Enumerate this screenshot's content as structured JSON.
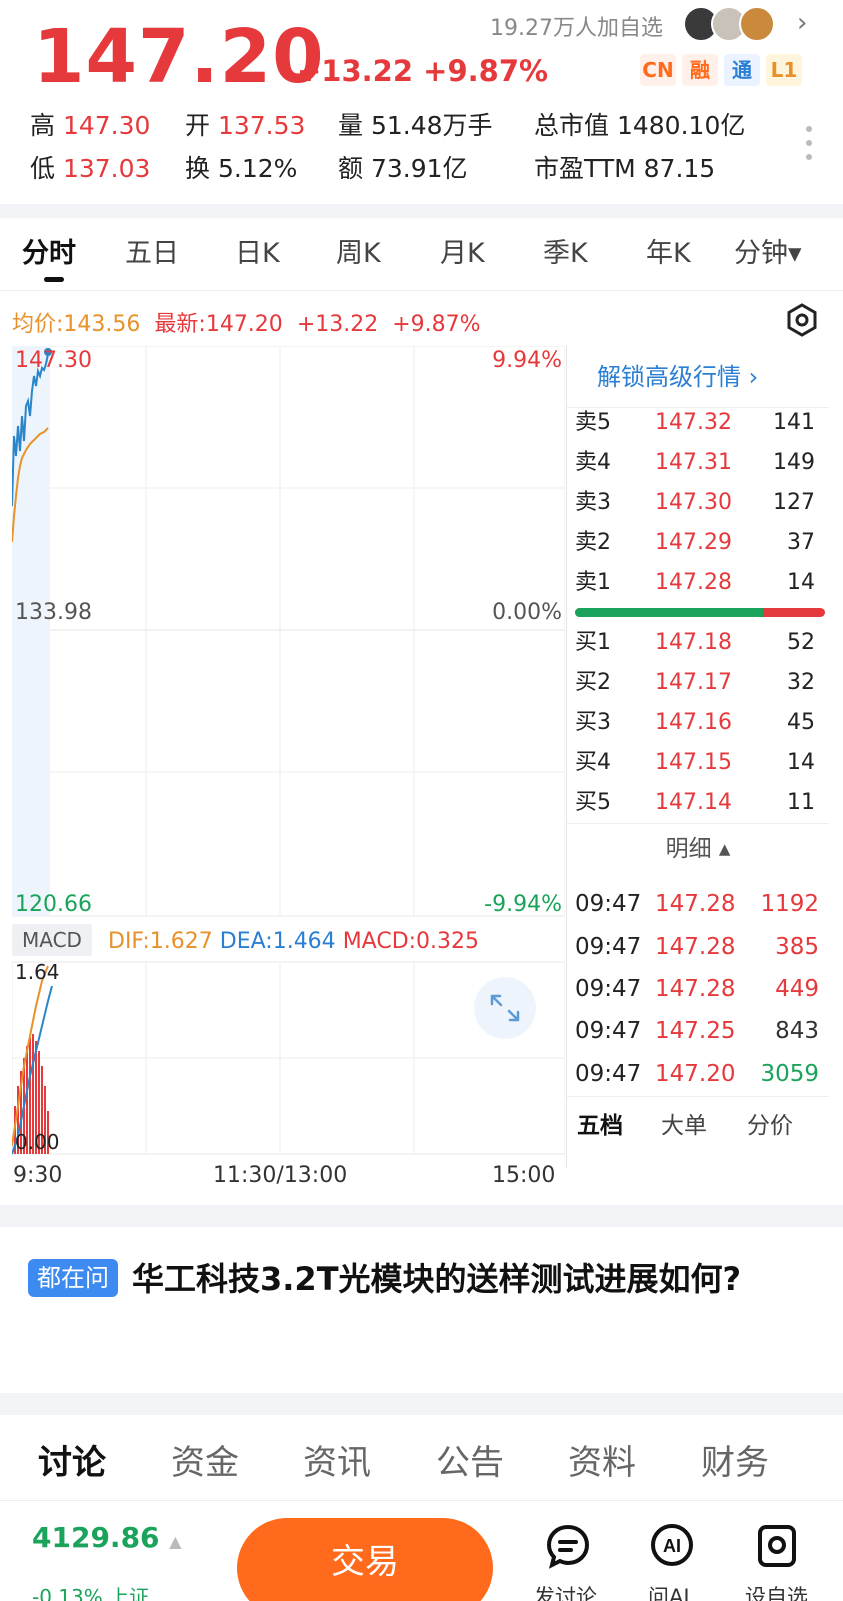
{
  "header": {
    "price": "147.20",
    "change": "+13.22",
    "change_pct": "+9.87%",
    "watch_count": "19.27万人加自选",
    "badges": [
      "CN",
      "融",
      "通",
      "L1"
    ],
    "stats": {
      "high_label": "高",
      "high": "147.30",
      "low_label": "低",
      "low": "137.03",
      "open_label": "开",
      "open": "137.53",
      "turnover_label": "换",
      "turnover": "5.12%",
      "volume_label": "量",
      "volume": "51.48万手",
      "amount_label": "额",
      "amount": "73.91亿",
      "mktcap_label": "总市值",
      "mktcap": "1480.10亿",
      "pe_label": "市盈TTM",
      "pe": "87.15"
    }
  },
  "tabs": [
    {
      "label": "分时"
    },
    {
      "label": "五日"
    },
    {
      "label": "日K"
    },
    {
      "label": "周K"
    },
    {
      "label": "月K"
    },
    {
      "label": "季K"
    },
    {
      "label": "年K"
    },
    {
      "label": "分钟▾"
    }
  ],
  "avg_line": {
    "avg": "均价:143.56",
    "latest": "最新:147.20",
    "chg": "+13.22",
    "pct": "+9.87%"
  },
  "chart": {
    "y_top": "147.30",
    "y_mid": "133.98",
    "y_bot": "120.66",
    "pct_top": "9.94%",
    "pct_mid": "0.00%",
    "pct_bot": "-9.94%",
    "x_labels": [
      "9:30",
      "11:30/13:00",
      "15:00"
    ],
    "macd_tag": "MACD",
    "dif": "DIF:1.627",
    "dea": "DEA:1.464",
    "macd": "MACD:0.325",
    "macd_top": "1.64",
    "macd_bot": "0.00"
  },
  "orderbook": {
    "unlock": "解锁高级行情 ›",
    "asks": [
      {
        "label": "卖5",
        "price": "147.32",
        "vol": "141"
      },
      {
        "label": "卖4",
        "price": "147.31",
        "vol": "149"
      },
      {
        "label": "卖3",
        "price": "147.30",
        "vol": "127"
      },
      {
        "label": "卖2",
        "price": "147.29",
        "vol": "37"
      },
      {
        "label": "卖1",
        "price": "147.28",
        "vol": "14"
      }
    ],
    "bids": [
      {
        "label": "买1",
        "price": "147.18",
        "vol": "52"
      },
      {
        "label": "买2",
        "price": "147.17",
        "vol": "32"
      },
      {
        "label": "买3",
        "price": "147.16",
        "vol": "45"
      },
      {
        "label": "买4",
        "price": "147.15",
        "vol": "14"
      },
      {
        "label": "买5",
        "price": "147.14",
        "vol": "11"
      }
    ],
    "detail_header": "明细 ▴",
    "details": [
      {
        "time": "09:47",
        "price": "147.28",
        "vol": "1192",
        "color": "#e5393c"
      },
      {
        "time": "09:47",
        "price": "147.28",
        "vol": "385",
        "color": "#e5393c"
      },
      {
        "time": "09:47",
        "price": "147.28",
        "vol": "449",
        "color": "#e5393c"
      },
      {
        "time": "09:47",
        "price": "147.25",
        "vol": "843",
        "color": "#333333"
      },
      {
        "time": "09:47",
        "price": "147.20",
        "vol": "3059",
        "color": "#1aa35a"
      }
    ],
    "bottom_tabs": [
      "五档",
      "大单",
      "分价"
    ]
  },
  "qa": {
    "badge": "都在问",
    "question": "华工科技3.2T光模块的送样测试进展如何?"
  },
  "news_tabs": [
    "讨论",
    "资金",
    "资讯",
    "公告",
    "资料",
    "财务"
  ],
  "bottom": {
    "index_value": "4129.86",
    "index_change": "-0.13% 上证",
    "trade": "交易",
    "btn_discuss": "发讨论",
    "btn_ai": "问AI",
    "btn_watch": "设自选"
  }
}
